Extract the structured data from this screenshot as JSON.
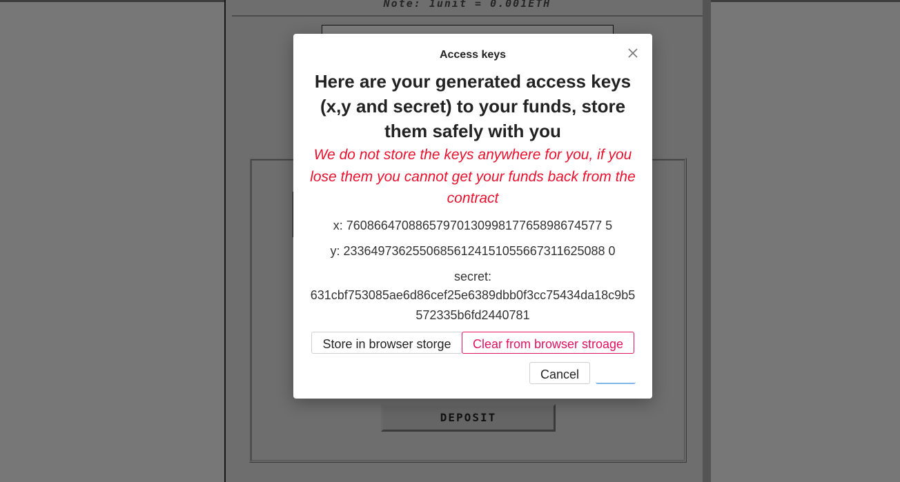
{
  "background": {
    "note_text": "Note: 1unit = 0.001ETH",
    "deposit_label": "DEPOSIT"
  },
  "modal": {
    "title": "Access keys",
    "headline": "Here are your generated access keys (x,y and secret) to your funds, store them safely with you",
    "warning": "We do not store the keys anywhere for you, if you lose them you cannot get your funds back from the contract",
    "x_line": "x: 7608664708865797013099817765898674577 5",
    "y_line": "y: 23364973625506856124151055667311625088 0",
    "secret_label": "secret:",
    "secret_value": "631cbf753085ae6d86cef25e6389dbb0f3cc75434da18c9b5572335b6fd2440781",
    "buttons": {
      "store": "Store in browser storge",
      "clear": "Clear from browser stroage",
      "cancel": "Cancel",
      "ok": ""
    }
  },
  "colors": {
    "warning": "#e8112d",
    "clear_button": "#e0115f",
    "ok_focus": "#7fb5e6"
  },
  "icons": [
    "close-icon"
  ]
}
